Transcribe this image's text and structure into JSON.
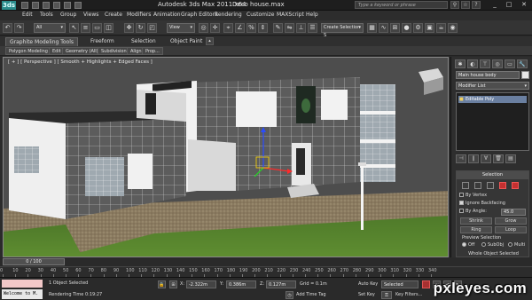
{
  "titlebar": {
    "app_logo": "3ds",
    "app_title": "Autodesk 3ds Max  2011 x64",
    "file_title": "Deco house.max",
    "search_placeholder": "Type a keyword or phrase",
    "window_controls": [
      "_",
      "□",
      "✕"
    ]
  },
  "menu": {
    "items": [
      "Edit",
      "Tools",
      "Group",
      "Views",
      "Create",
      "Modifiers",
      "Animation",
      "Graph Editors",
      "Rendering",
      "Customize",
      "MAXScript",
      "Help"
    ]
  },
  "toolbar": {
    "filter_dropdown": "All",
    "refcoord_dropdown": "View",
    "selection_set_dropdown": "Create Selection S"
  },
  "ribbon": {
    "tabs": [
      "Graphite Modeling Tools",
      "Freeform",
      "Selection",
      "Object Paint"
    ],
    "subtabs": [
      "Polygon Modeling",
      "Edit",
      "Geometry (All)",
      "Subdivision",
      "Align",
      "Prop..."
    ]
  },
  "viewport": {
    "label": "[ + ] [ Perspective ] [ Smooth + Highlights + Edged Faces ]"
  },
  "command_panel": {
    "object_name": "Main house body",
    "modifier_list": "Modifier List",
    "stack_item": "Editable Poly",
    "rollout_title": "Selection",
    "by_vertex": "By Vertex",
    "ignore_backfacing": "Ignore Backfacing",
    "by_angle": "By Angle:",
    "by_angle_value": "45.0",
    "shrink": "Shrink",
    "grow": "Grow",
    "ring": "Ring",
    "loop": "Loop",
    "preview_selection": "Preview Selection",
    "preview_off": "Off",
    "preview_subobj": "SubObj",
    "preview_multi": "Multi",
    "whole_object": "Whole Object Selected"
  },
  "timeline": {
    "frame_indicator": "0 / 100",
    "ticks": [
      "0",
      "10",
      "20",
      "30",
      "40",
      "50",
      "60",
      "70",
      "80",
      "90",
      "100",
      "110",
      "120",
      "130",
      "140",
      "150",
      "160",
      "170",
      "180",
      "190",
      "200",
      "210",
      "220",
      "230",
      "240",
      "250",
      "260",
      "270",
      "280",
      "290",
      "300",
      "310",
      "320",
      "330",
      "340"
    ]
  },
  "status": {
    "maxscript_line": "Welcome to M.",
    "objects_selected": "1 Object Selected",
    "rendering_time": "Rendering Time  0:19:27",
    "x_label": "X:",
    "x_value": "-2.322m",
    "y_label": "Y:",
    "y_value": "0.386m",
    "z_label": "Z:",
    "z_value": "0.127m",
    "grid": "Grid = 0.1m",
    "add_time_tag": "Add Time Tag",
    "auto_key": "Auto Key",
    "set_key": "Set Key",
    "key_filter_dropdown": "Selected",
    "key_filters": "Key Filters..."
  },
  "watermark": "pxleyes.com",
  "colors": {
    "accent_red": "#c43030",
    "stack_highlight": "#6a7fa0",
    "maxscript_bg": "#f2c8c8"
  }
}
